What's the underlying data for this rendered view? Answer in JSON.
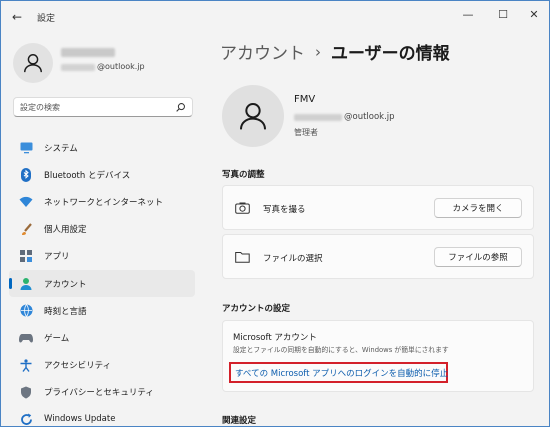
{
  "window": {
    "title": "設定",
    "back_glyph": "←",
    "min_glyph": "—",
    "max_glyph": "☐",
    "close_glyph": "✕"
  },
  "sidebar": {
    "user_email_suffix": "@outlook.jp",
    "search": {
      "placeholder": "設定の検索"
    },
    "items": [
      {
        "label": "システム",
        "icon": "system-icon",
        "active": false
      },
      {
        "label": "Bluetooth とデバイス",
        "icon": "bluetooth-icon",
        "active": false
      },
      {
        "label": "ネットワークとインターネット",
        "icon": "network-icon",
        "active": false
      },
      {
        "label": "個人用設定",
        "icon": "personalization-icon",
        "active": false
      },
      {
        "label": "アプリ",
        "icon": "apps-icon",
        "active": false
      },
      {
        "label": "アカウント",
        "icon": "accounts-icon",
        "active": true
      },
      {
        "label": "時刻と言語",
        "icon": "time-language-icon",
        "active": false
      },
      {
        "label": "ゲーム",
        "icon": "gaming-icon",
        "active": false
      },
      {
        "label": "アクセシビリティ",
        "icon": "accessibility-icon",
        "active": false
      },
      {
        "label": "プライバシーとセキュリティ",
        "icon": "privacy-icon",
        "active": false
      },
      {
        "label": "Windows Update",
        "icon": "windows-update-icon",
        "active": false
      }
    ]
  },
  "header": {
    "breadcrumb_parent": "アカウント",
    "breadcrumb_sep": "›",
    "breadcrumb_current": "ユーザーの情報"
  },
  "profile": {
    "name": "FMV",
    "email_suffix": "@outlook.jp",
    "role": "管理者"
  },
  "photo_section": {
    "title": "写真の調整",
    "rows": [
      {
        "label": "写真を撮る",
        "button": "カメラを開く",
        "icon": "camera-icon"
      },
      {
        "label": "ファイルの選択",
        "button": "ファイルの参照",
        "icon": "folder-icon"
      }
    ]
  },
  "account_settings": {
    "title": "アカウントの設定",
    "ms_title": "Microsoft アカウント",
    "ms_desc": "設定とファイルの同期を自動的にすると、Windows が簡単にされます",
    "ms_link": "すべての Microsoft アプリへのログインを自動的に停止",
    "highlight_color": "#d3202a"
  },
  "related": {
    "title": "関連設定"
  },
  "colors": {
    "accent": "#0067c0",
    "link": "#0b5cad"
  }
}
